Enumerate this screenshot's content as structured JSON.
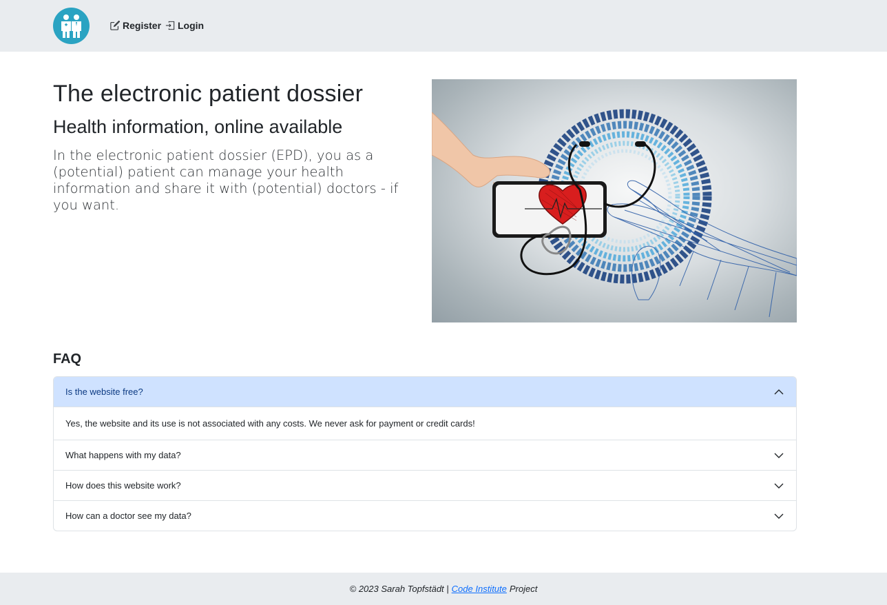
{
  "nav": {
    "logo_icon": "doctor-and-patient-icon",
    "register_label": "Register",
    "register_icon": "pencil-square-icon",
    "login_label": "Login",
    "login_icon": "box-arrow-in-right-icon"
  },
  "hero": {
    "title": "The electronic patient dossier",
    "subtitle": "Health information, online available",
    "text": "In the electronic patient dossier (EPD), you as a (potential) patient can manage your health information and share it with (potential) doctors - if you want.",
    "image_icon": "phone-heart-stethoscope-digital-hand-illustration"
  },
  "faq": {
    "title": "FAQ",
    "items": [
      {
        "question": "Is the website free?",
        "answer": "Yes, the website and its use is not associated with any costs. We never ask for payment or credit cards!",
        "expanded": true
      },
      {
        "question": "What happens with my data?",
        "expanded": false
      },
      {
        "question": "How does this website work?",
        "expanded": false
      },
      {
        "question": "How can a doctor see my data?",
        "expanded": false
      }
    ]
  },
  "footer": {
    "prefix": "© 2023 Sarah Topfstädt |",
    "link_label": "Code Institute",
    "suffix": "Project"
  },
  "colors": {
    "navbar_bg": "#e9ecef",
    "logo_bg": "#2aa3c2",
    "accordion_open_bg": "#cfe2ff",
    "link": "#0d6efd"
  }
}
